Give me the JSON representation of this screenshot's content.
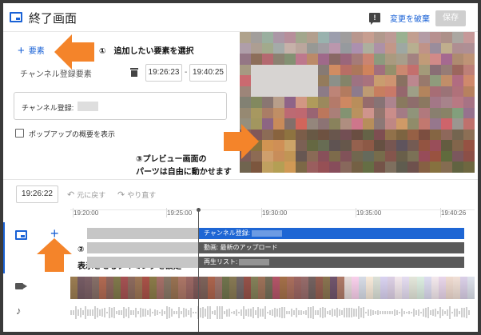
{
  "header": {
    "title": "終了画面",
    "discard_label": "変更を破棄",
    "save_label": "保存",
    "feedback_icon": "feedback-icon"
  },
  "editor": {
    "add_element_label": "要素",
    "element_name": "チャンネル登録要素",
    "start_time": "19:26:23",
    "time_separator": "-",
    "end_time": "19:40:25",
    "channel_label": "チャンネル登録:",
    "popup_checkbox_label": "ポップアップの概要を表示"
  },
  "annotations": {
    "callout_1": "①　追加したい要素を選択",
    "callout_2_line1": "②",
    "callout_2_line2": "表示させるタイミングを設定",
    "callout_3_line1": "③プレビュー画面の",
    "callout_3_line2": "パーツは自由に動かせます"
  },
  "toolbar": {
    "current_time": "19:26:22",
    "undo_label": "元に戻す",
    "redo_label": "やり直す"
  },
  "timeline": {
    "ticks": [
      "19:20:00",
      "19:25:00",
      "19:30:00",
      "19:35:00",
      "19:40:26"
    ],
    "bars": [
      {
        "label": "チャンネル登録:"
      },
      {
        "label": "動画: 最新のアップロード"
      },
      {
        "label": "再生リスト:"
      }
    ]
  },
  "colors": {
    "accent": "#1a62d6",
    "arrow": "#f4842a",
    "bar_active": "#1e66d4",
    "bar_dark": "#5a5a5a",
    "bar_grey": "#c6c6c6"
  }
}
